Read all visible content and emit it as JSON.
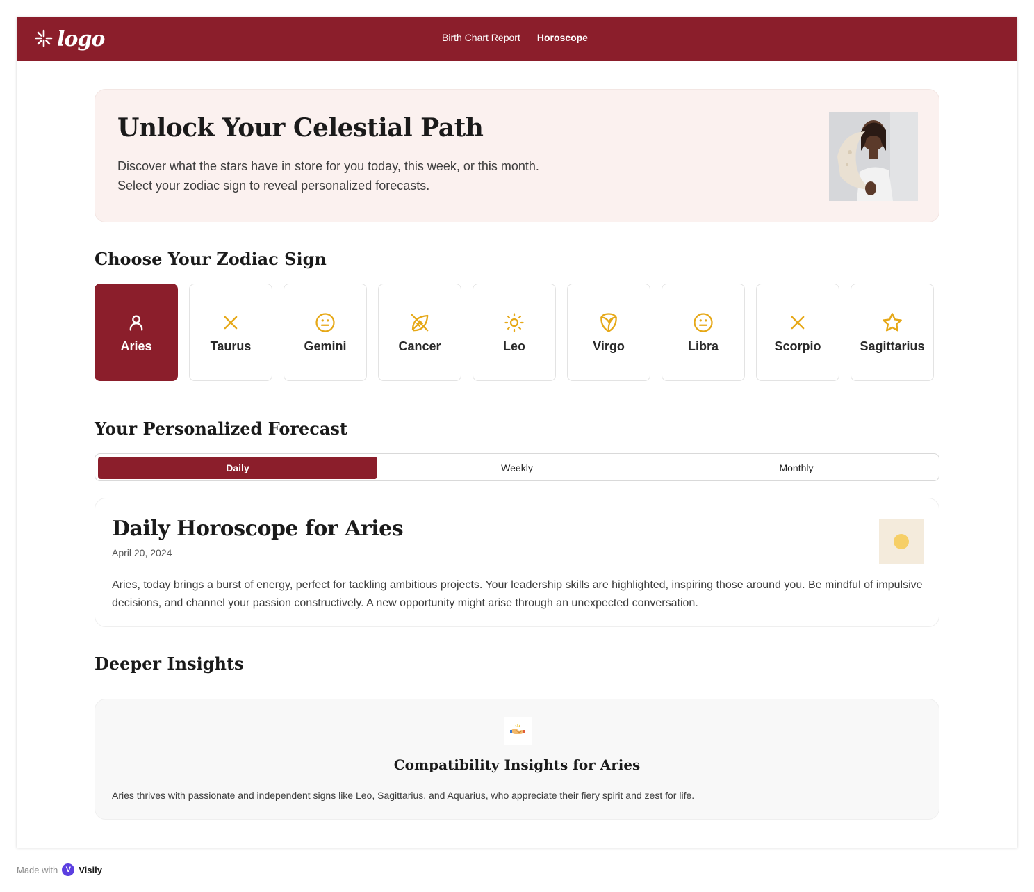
{
  "nav": {
    "logo": "logo",
    "links": [
      {
        "label": "Birth Chart Report",
        "active": false
      },
      {
        "label": "Horoscope",
        "active": true
      }
    ]
  },
  "hero": {
    "title": "Unlock Your Celestial Path",
    "subtitle_line1": "Discover what the stars have in store for you today, this week, or this month.",
    "subtitle_line2": "Select your zodiac sign to reveal personalized forecasts."
  },
  "zodiac": {
    "heading": "Choose Your Zodiac Sign",
    "signs": [
      {
        "name": "Aries",
        "icon": "person-icon",
        "active": true
      },
      {
        "name": "Taurus",
        "icon": "x-icon",
        "active": false
      },
      {
        "name": "Gemini",
        "icon": "neutral-face-icon",
        "active": false
      },
      {
        "name": "Cancer",
        "icon": "leaf-off-icon",
        "active": false
      },
      {
        "name": "Leo",
        "icon": "sun-icon",
        "active": false
      },
      {
        "name": "Virgo",
        "icon": "vegan-icon",
        "active": false
      },
      {
        "name": "Libra",
        "icon": "neutral-face-icon",
        "active": false
      },
      {
        "name": "Scorpio",
        "icon": "x-icon",
        "active": false
      },
      {
        "name": "Sagittarius",
        "icon": "star-icon",
        "active": false
      }
    ]
  },
  "forecast": {
    "heading": "Your Personalized Forecast",
    "tabs": [
      {
        "label": "Daily",
        "active": true
      },
      {
        "label": "Weekly",
        "active": false
      },
      {
        "label": "Monthly",
        "active": false
      }
    ],
    "title": "Daily Horoscope for Aries",
    "date": "April 20, 2024",
    "body": "Aries, today brings a burst of energy, perfect for tackling ambitious projects. Your leadership skills are highlighted, inspiring those around you. Be mindful of impulsive decisions, and channel your passion constructively. A new opportunity might arise through an unexpected conversation."
  },
  "insights": {
    "heading": "Deeper Insights",
    "card_icon": "handshake-icon",
    "card_title": "Compatibility Insights for Aries",
    "card_body": "Aries thrives with passionate and independent signs like Leo, Sagittarius, and Aquarius, who appreciate their fiery spirit and zest for life."
  },
  "footer": {
    "made_with": "Made with",
    "brand": "Visily"
  },
  "colors": {
    "brand": "#8b1e2b",
    "icon_gold": "#e6a817",
    "hero_bg": "#fbf1ef"
  }
}
